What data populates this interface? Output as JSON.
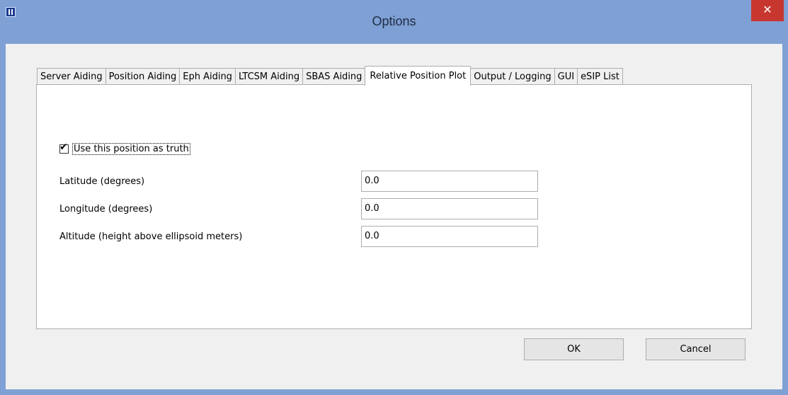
{
  "window": {
    "title": "Options",
    "close_glyph": "✕"
  },
  "tabs": [
    {
      "label": "Server Aiding"
    },
    {
      "label": "Position Aiding"
    },
    {
      "label": "Eph Aiding"
    },
    {
      "label": "LTCSM Aiding"
    },
    {
      "label": "SBAS Aiding"
    },
    {
      "label": "Relative Position Plot",
      "active": true
    },
    {
      "label": "Output / Logging"
    },
    {
      "label": "GUI"
    },
    {
      "label": "eSIP List"
    }
  ],
  "panel": {
    "truth_checkbox": {
      "label": "Use this position as truth",
      "checked": true,
      "mark": "✔"
    },
    "fields": [
      {
        "label": "Latitude (degrees)",
        "value": "0.0"
      },
      {
        "label": "Longitude (degrees)",
        "value": "0.0"
      },
      {
        "label": "Altitude (height above ellipsoid meters)",
        "value": "0.0"
      }
    ]
  },
  "buttons": {
    "ok": "OK",
    "cancel": "Cancel"
  },
  "colors": {
    "titlebar": "#7fa0d4",
    "close": "#c7372f"
  }
}
